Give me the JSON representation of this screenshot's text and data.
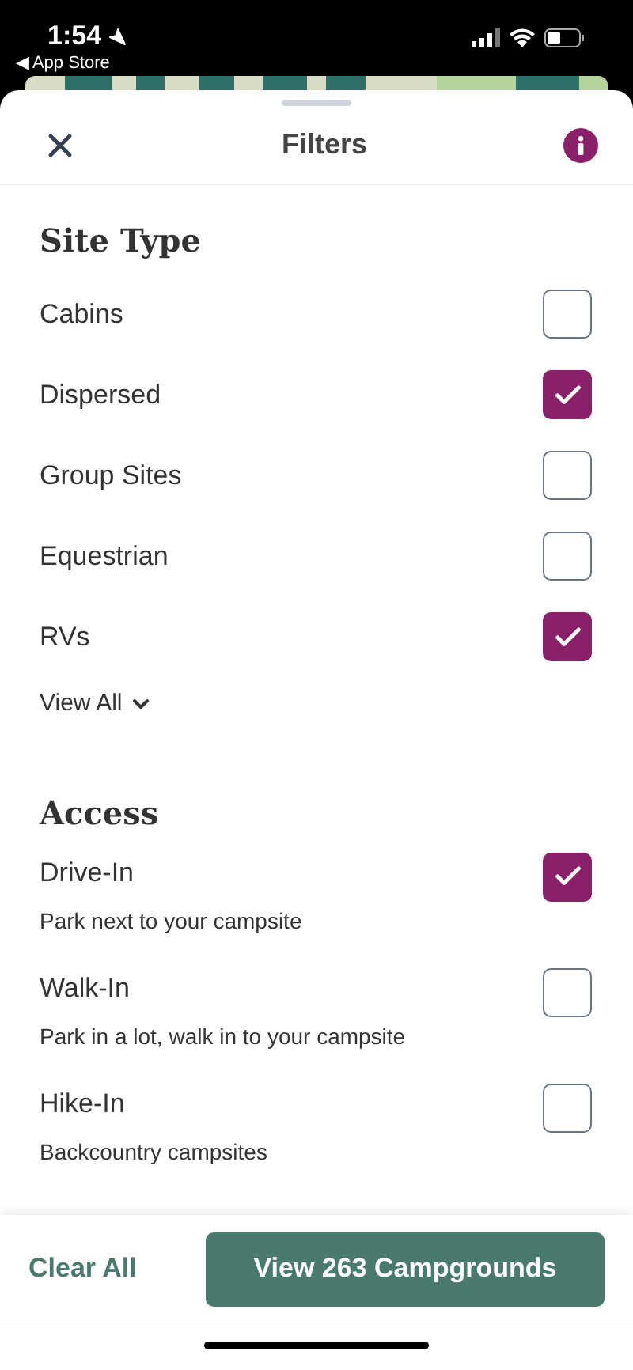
{
  "status_bar": {
    "time": "1:54",
    "back_link": "◀ App Store"
  },
  "header": {
    "title": "Filters"
  },
  "sections": [
    {
      "title": "Site Type",
      "options": [
        {
          "label": "Cabins",
          "checked": false
        },
        {
          "label": "Dispersed",
          "checked": true
        },
        {
          "label": "Group Sites",
          "checked": false
        },
        {
          "label": "Equestrian",
          "checked": false
        },
        {
          "label": "RVs",
          "checked": true
        }
      ],
      "view_all": "View All"
    },
    {
      "title": "Access",
      "options": [
        {
          "label": "Drive-In",
          "description": "Park next to your campsite",
          "checked": true
        },
        {
          "label": "Walk-In",
          "description": "Park in a lot, walk in to your campsite",
          "checked": false
        },
        {
          "label": "Hike-In",
          "description": "Backcountry campsites",
          "checked": false
        }
      ]
    }
  ],
  "footer": {
    "clear": "Clear All",
    "apply": "View 263 Campgrounds"
  }
}
